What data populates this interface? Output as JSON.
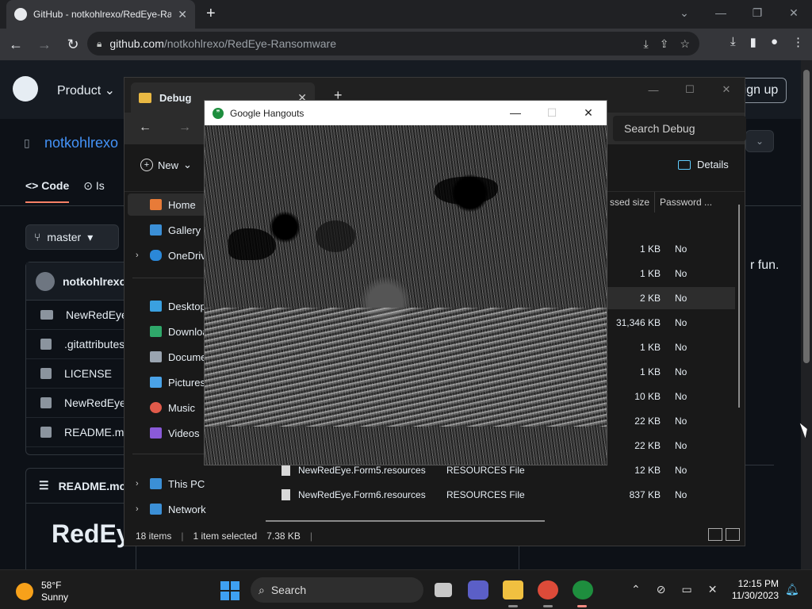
{
  "chrome": {
    "tab_title": "GitHub - notkohlrexo/RedEye-Ra",
    "url_host": "github.com",
    "url_path": "/notkohlrexo/RedEye-Ransomware"
  },
  "github": {
    "nav_product": "Product",
    "signup": "Sign up",
    "repo_name": "notkohlrexo",
    "tabs": [
      "Code",
      "Is"
    ],
    "branch": "master",
    "commit_author": "notkohlrexo",
    "files": [
      "NewRedEye",
      ".gitattributes",
      "LICENSE",
      "NewRedEye.",
      "README.mc"
    ],
    "readme_label": "README.mc",
    "readme_heading": "RedEye",
    "about_text": "r fun."
  },
  "explorer": {
    "tab_title": "Debug",
    "search_placeholder": "Search Debug",
    "new_label": "New",
    "details_label": "Details",
    "columns": [
      "ssed size",
      "Password ..."
    ],
    "sidebar": {
      "home": "Home",
      "gallery": "Gallery",
      "onedrive": "OneDrive",
      "desktop": "Desktop",
      "downloads": "Downloa",
      "documents": "Docume",
      "pictures": "Pictures",
      "music": "Music",
      "videos": "Videos",
      "thispc": "This PC",
      "network": "Network"
    },
    "rows": [
      {
        "name": "",
        "type": "",
        "size": "1 KB",
        "pw": "No"
      },
      {
        "name": "",
        "type": "",
        "size": "1 KB",
        "pw": "No"
      },
      {
        "name": "",
        "type": "",
        "size": "2 KB",
        "pw": "No"
      },
      {
        "name": "",
        "type": "",
        "size": "31,346 KB",
        "pw": "No"
      },
      {
        "name": "",
        "type": "",
        "size": "1 KB",
        "pw": "No"
      },
      {
        "name": "",
        "type": "",
        "size": "1 KB",
        "pw": "No"
      },
      {
        "name": "",
        "type": "",
        "size": "10 KB",
        "pw": "No"
      },
      {
        "name": "",
        "type": "",
        "size": "22 KB",
        "pw": "No"
      },
      {
        "name": "",
        "type": "",
        "size": "22 KB",
        "pw": "No"
      },
      {
        "name": "NewRedEye.Form5.resources",
        "type": "RESOURCES File",
        "size": "12 KB",
        "pw": "No"
      },
      {
        "name": "NewRedEye.Form6.resources",
        "type": "RESOURCES File",
        "size": "837 KB",
        "pw": "No"
      }
    ],
    "status_items": "18 items",
    "status_selected": "1 item selected",
    "status_size": "7.38 KB"
  },
  "hangouts": {
    "title": "Google Hangouts"
  },
  "taskbar": {
    "temp": "58°F",
    "condition": "Sunny",
    "search": "Search",
    "time": "12:15 PM",
    "date": "11/30/2023"
  }
}
